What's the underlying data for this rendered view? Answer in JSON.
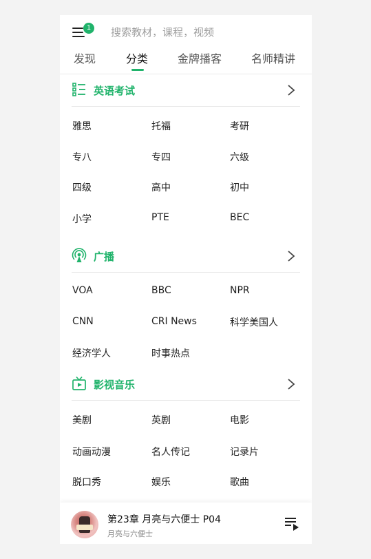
{
  "header": {
    "notification_count": "1",
    "search_placeholder": "搜索教材，课程，视频"
  },
  "tabs": [
    {
      "label": "发现"
    },
    {
      "label": "分类"
    },
    {
      "label": "金牌播客"
    },
    {
      "label": "名师精讲"
    }
  ],
  "sections": [
    {
      "title": "英语考试",
      "icon": "list-check-icon",
      "items": [
        "雅思",
        "托福",
        "考研",
        "专八",
        "专四",
        "六级",
        "四级",
        "高中",
        "初中",
        "小学",
        "PTE",
        "BEC"
      ]
    },
    {
      "title": "广播",
      "icon": "broadcast-icon",
      "items": [
        "VOA",
        "BBC",
        "NPR",
        "CNN",
        "CRI News",
        "科学美国人",
        "经济学人",
        "时事热点"
      ]
    },
    {
      "title": "影视音乐",
      "icon": "tv-icon",
      "items": [
        "美剧",
        "英剧",
        "电影",
        "动画动漫",
        "名人传记",
        "记录片",
        "脱口秀",
        "娱乐",
        "歌曲"
      ]
    }
  ],
  "player": {
    "title": "第23章 月亮与六便士 P04",
    "subtitle": "月亮与六便士"
  },
  "colors": {
    "accent": "#20b36b",
    "text": "#222222",
    "muted": "#9c9c9c"
  }
}
